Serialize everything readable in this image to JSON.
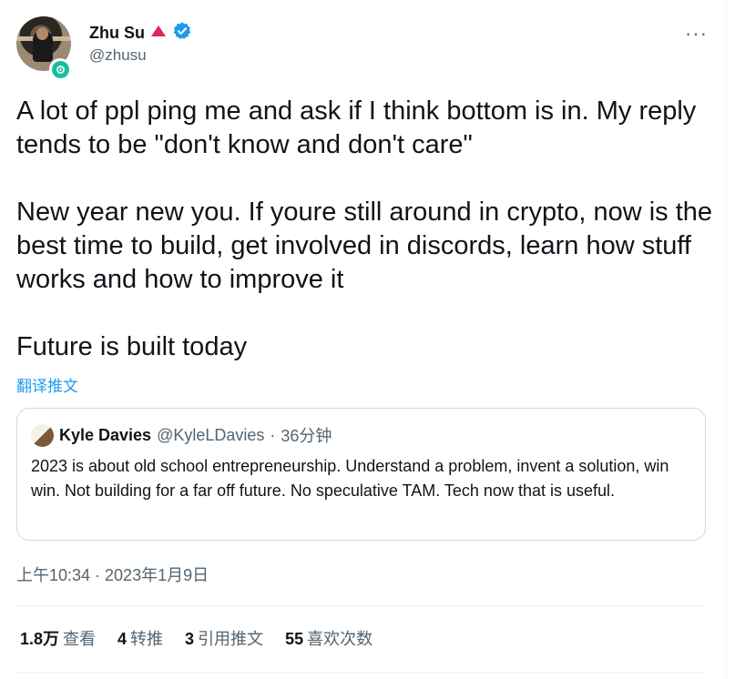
{
  "author": {
    "name": "Zhu Su",
    "handle": "@zhusu",
    "avatar_icon": "profile-photo",
    "name_emoji_icon": "red-triangle-icon",
    "verified_icon": "verified-badge-icon",
    "verified_color": "#1d9bf0"
  },
  "tweet": {
    "paragraphs": [
      "A lot of ppl ping me and ask if I think bottom is in. My reply tends to be \"don't know and don't care\"",
      "New year new you. If youre still around in crypto, now is the best time to build, get involved in discords, learn how stuff works and how to improve it",
      "Future is built today"
    ],
    "translate_label": "翻译推文",
    "timestamp": "上午10:34 · 2023年1月9日"
  },
  "quoted_tweet": {
    "name": "Kyle Davies",
    "handle": "@KyleLDavies",
    "separator": "·",
    "time": "36分钟",
    "text": "2023 is about old school entrepreneurship. Understand a problem, invent a solution, win win. Not building for a far off future. No speculative TAM. Tech now that is useful."
  },
  "stats": [
    {
      "value": "1.8万",
      "label": "查看"
    },
    {
      "value": "4",
      "label": "转推"
    },
    {
      "value": "3",
      "label": "引用推文"
    },
    {
      "value": "55",
      "label": "喜欢次数"
    }
  ],
  "more_label": "···",
  "colors": {
    "accent": "#1d9bf0",
    "text": "#0f1419",
    "muted": "#536471",
    "border": "#cfd9de"
  }
}
